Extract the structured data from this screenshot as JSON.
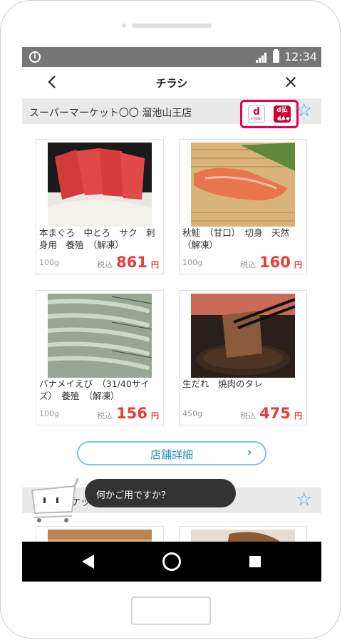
{
  "status_bar": {
    "time": "12:34",
    "info_icon": "i"
  },
  "header": {
    "title": "チラシ",
    "back_icon": "chevron-left-icon",
    "close_icon": "close-icon"
  },
  "store": {
    "name": "スーパーマーケット〇〇 溜池山王店",
    "payment_badges": [
      {
        "label": "d",
        "sub": "d POINT"
      },
      {
        "label": "d払い",
        "sub": "●●●"
      }
    ],
    "favorite_icon": "star-icon"
  },
  "products": [
    {
      "name": "本まぐろ　中とろ　サク　刺身用　養殖　（解凍）",
      "weight": "100g",
      "tax_label": "税込",
      "price": "861",
      "unit": "円"
    },
    {
      "name": "秋鮭　（甘口）　切身　天然（解凍）",
      "weight": "100g",
      "tax_label": "税込",
      "price": "160",
      "unit": "円"
    },
    {
      "name": "バナメイえび　（31/40サイズ）　養殖　（解凍）",
      "weight": "100g",
      "tax_label": "税込",
      "price": "156",
      "unit": "円"
    },
    {
      "name": "生だれ　焼肉のタレ",
      "weight": "450g",
      "tax_label": "税込",
      "price": "475",
      "unit": "円"
    }
  ],
  "detail_button": {
    "label": "店舗詳細"
  },
  "store2": {
    "name_fragment": "ケット"
  },
  "assistant": {
    "message": "何かご用ですか？"
  },
  "colors": {
    "accent_blue": "#2a8fc4",
    "price_red": "#e83c3c",
    "highlight_pink": "#e6004c"
  }
}
